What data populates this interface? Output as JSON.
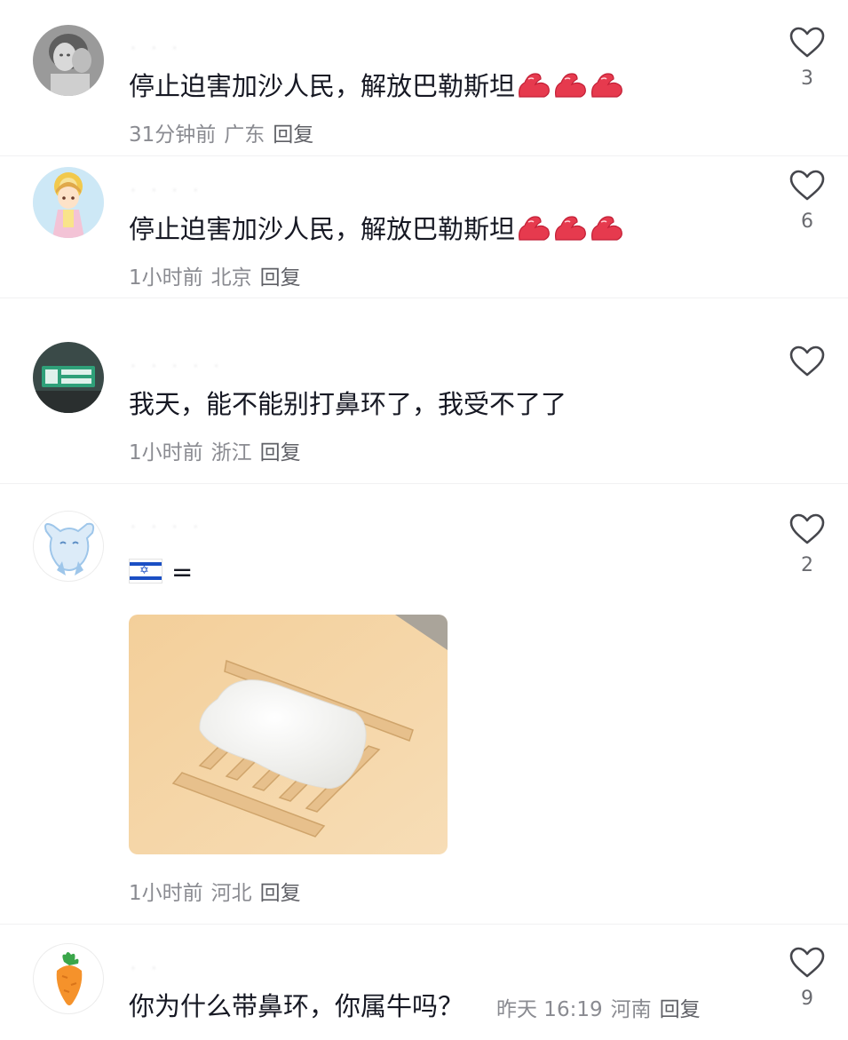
{
  "comments": [
    {
      "username": "· · ·",
      "text": "停止迫害加沙人民，解放巴勒斯坦",
      "emoji_count": 3,
      "emoji_name": "muscle-emoji",
      "time": "31分钟前",
      "location": "广东",
      "reply": "回复",
      "likes": "3"
    },
    {
      "username": "· · · ·",
      "text": "停止迫害加沙人民，解放巴勒斯坦",
      "emoji_count": 3,
      "emoji_name": "muscle-emoji",
      "time": "1小时前",
      "location": "北京",
      "reply": "回复",
      "likes": "6"
    },
    {
      "username": "· · · · ·",
      "text": "我天，能不能别打鼻环了，我受不了了",
      "time": "1小时前",
      "location": "浙江",
      "reply": "回复",
      "likes": ""
    },
    {
      "username": "· · · ·",
      "text": "=",
      "flag_icon": "israel-flag-icon",
      "image_icon": "soap-on-dish-image",
      "time": "1小时前",
      "location": "河北",
      "reply": "回复",
      "likes": "2"
    },
    {
      "username": "· ·",
      "text": "你为什么带鼻环，你属牛吗？",
      "time": "昨天 16:19",
      "location": "河南",
      "reply": "回复",
      "likes": "9"
    }
  ],
  "colors": {
    "text": "#161823",
    "meta": "#8a8b91",
    "reply": "#5f6066",
    "heart_outline": "#45464c",
    "muscle": "#e63a4e"
  }
}
